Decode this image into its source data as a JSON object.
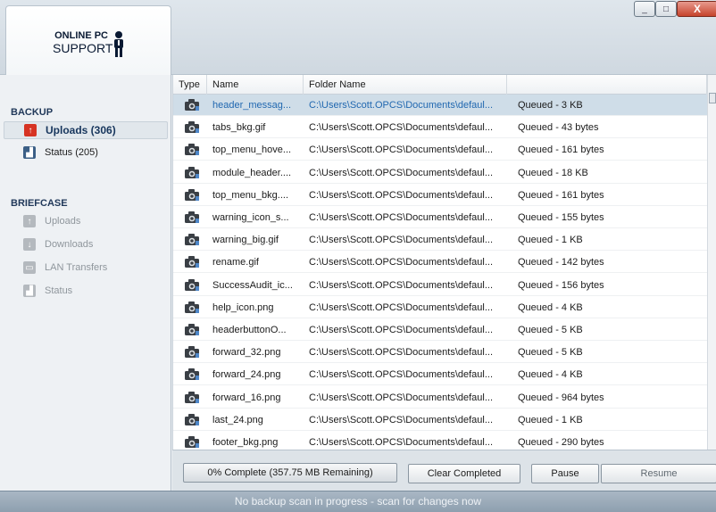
{
  "logo": {
    "line1": "ONLINE PC",
    "line2": "SUPPORT"
  },
  "window_controls": {
    "minimize": "_",
    "maximize": "□",
    "close": "X"
  },
  "sidebar": {
    "backup_title": "BACKUP",
    "backup_items": [
      {
        "label": "Uploads (306)",
        "icon": "upload-arrow-icon",
        "active": true
      },
      {
        "label": "Status (205)",
        "icon": "status-chart-icon",
        "active": false
      }
    ],
    "briefcase_title": "BRIEFCASE",
    "briefcase_items": [
      {
        "label": "Uploads",
        "icon": "upload-arrow-icon"
      },
      {
        "label": "Downloads",
        "icon": "download-arrow-icon"
      },
      {
        "label": "LAN Transfers",
        "icon": "lan-transfer-icon"
      },
      {
        "label": "Status",
        "icon": "status-chart-icon"
      }
    ]
  },
  "grid": {
    "columns": [
      "Type",
      "Name",
      "Folder Name"
    ],
    "rows": [
      {
        "name": "header_messag...",
        "folder": "C:\\Users\\Scott.OPCS\\Documents\\defaul...",
        "status": "Queued - 3 KB",
        "selected": true
      },
      {
        "name": "tabs_bkg.gif",
        "folder": "C:\\Users\\Scott.OPCS\\Documents\\defaul...",
        "status": "Queued - 43 bytes"
      },
      {
        "name": "top_menu_hove...",
        "folder": "C:\\Users\\Scott.OPCS\\Documents\\defaul...",
        "status": "Queued - 161 bytes"
      },
      {
        "name": "module_header....",
        "folder": "C:\\Users\\Scott.OPCS\\Documents\\defaul...",
        "status": "Queued - 18 KB"
      },
      {
        "name": "top_menu_bkg....",
        "folder": "C:\\Users\\Scott.OPCS\\Documents\\defaul...",
        "status": "Queued - 161 bytes"
      },
      {
        "name": "warning_icon_s...",
        "folder": "C:\\Users\\Scott.OPCS\\Documents\\defaul...",
        "status": "Queued - 155 bytes"
      },
      {
        "name": "warning_big.gif",
        "folder": "C:\\Users\\Scott.OPCS\\Documents\\defaul...",
        "status": "Queued - 1 KB"
      },
      {
        "name": "rename.gif",
        "folder": "C:\\Users\\Scott.OPCS\\Documents\\defaul...",
        "status": "Queued - 142 bytes"
      },
      {
        "name": "SuccessAudit_ic...",
        "folder": "C:\\Users\\Scott.OPCS\\Documents\\defaul...",
        "status": "Queued - 156 bytes"
      },
      {
        "name": "help_icon.png",
        "folder": "C:\\Users\\Scott.OPCS\\Documents\\defaul...",
        "status": "Queued - 4 KB"
      },
      {
        "name": "headerbuttonO...",
        "folder": "C:\\Users\\Scott.OPCS\\Documents\\defaul...",
        "status": "Queued - 5 KB"
      },
      {
        "name": "forward_32.png",
        "folder": "C:\\Users\\Scott.OPCS\\Documents\\defaul...",
        "status": "Queued - 5 KB"
      },
      {
        "name": "forward_24.png",
        "folder": "C:\\Users\\Scott.OPCS\\Documents\\defaul...",
        "status": "Queued - 4 KB"
      },
      {
        "name": "forward_16.png",
        "folder": "C:\\Users\\Scott.OPCS\\Documents\\defaul...",
        "status": "Queued - 964 bytes"
      },
      {
        "name": "last_24.png",
        "folder": "C:\\Users\\Scott.OPCS\\Documents\\defaul...",
        "status": "Queued - 1 KB"
      },
      {
        "name": "footer_bkg.png",
        "folder": "C:\\Users\\Scott.OPCS\\Documents\\defaul...",
        "status": "Queued - 290 bytes"
      }
    ]
  },
  "toolbar": {
    "progress_label": "0% Complete (357.75 MB Remaining)",
    "progress_fraction": 0,
    "clear_label": "Clear Completed",
    "pause_label": "Pause",
    "resume_label": "Resume"
  },
  "statusbar": {
    "text": "No backup scan in progress - scan for changes now"
  },
  "colors": {
    "accent_red": "#d63323",
    "selection": "#cfdde8",
    "link_blue": "#2168b0",
    "section_title": "#21395a"
  }
}
